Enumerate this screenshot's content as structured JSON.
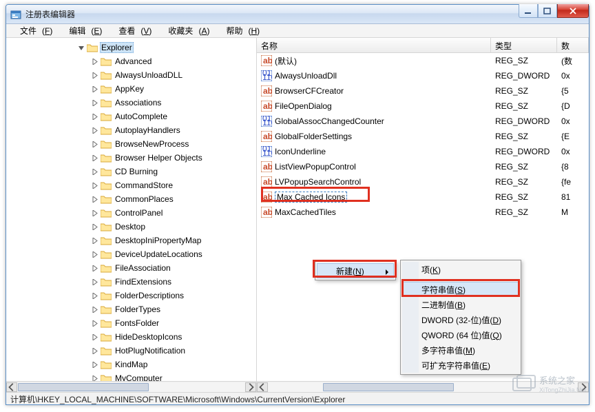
{
  "window": {
    "title": "注册表编辑器"
  },
  "menubar": [
    {
      "label": "文件",
      "mn": "F"
    },
    {
      "label": "编辑",
      "mn": "E"
    },
    {
      "label": "查看",
      "mn": "V"
    },
    {
      "label": "收藏夹",
      "mn": "A"
    },
    {
      "label": "帮助",
      "mn": "H"
    }
  ],
  "tree": {
    "root_label": "Explorer",
    "items": [
      "Advanced",
      "AlwaysUnloadDLL",
      "AppKey",
      "Associations",
      "AutoComplete",
      "AutoplayHandlers",
      "BrowseNewProcess",
      "Browser Helper Objects",
      "CD Burning",
      "CommandStore",
      "CommonPlaces",
      "ControlPanel",
      "Desktop",
      "DesktopIniPropertyMap",
      "DeviceUpdateLocations",
      "FileAssociation",
      "FindExtensions",
      "FolderDescriptions",
      "FolderTypes",
      "FontsFolder",
      "HideDesktopIcons",
      "HotPlugNotification",
      "KindMap",
      "MyComputer"
    ]
  },
  "list": {
    "headers": {
      "name": "名称",
      "type": "类型",
      "data": "数"
    },
    "rows": [
      {
        "name": "(默认)",
        "type": "REG_SZ",
        "data": "(数",
        "kind": "str"
      },
      {
        "name": "AlwaysUnloadDll",
        "type": "REG_DWORD",
        "data": "0x",
        "kind": "bin"
      },
      {
        "name": "BrowserCFCreator",
        "type": "REG_SZ",
        "data": "{5",
        "kind": "str"
      },
      {
        "name": "FileOpenDialog",
        "type": "REG_SZ",
        "data": "{D",
        "kind": "str"
      },
      {
        "name": "GlobalAssocChangedCounter",
        "type": "REG_DWORD",
        "data": "0x",
        "kind": "bin"
      },
      {
        "name": "GlobalFolderSettings",
        "type": "REG_SZ",
        "data": "{E",
        "kind": "str"
      },
      {
        "name": "IconUnderline",
        "type": "REG_DWORD",
        "data": "0x",
        "kind": "bin"
      },
      {
        "name": "ListViewPopupControl",
        "type": "REG_SZ",
        "data": "{8",
        "kind": "str"
      },
      {
        "name": "LVPopupSearchControl",
        "type": "REG_SZ",
        "data": "{fe",
        "kind": "str"
      },
      {
        "name": "Max Cached Icons",
        "type": "REG_SZ",
        "data": "81",
        "kind": "str",
        "editing": true
      },
      {
        "name": "MaxCachedTiles",
        "type": "REG_SZ",
        "data": "M",
        "kind": "str"
      }
    ]
  },
  "ctx1": {
    "label": "新建",
    "mn": "N"
  },
  "ctx2": [
    {
      "label": "项",
      "mn": "K"
    },
    {
      "sep": true
    },
    {
      "label": "字符串值",
      "mn": "S",
      "hov": true
    },
    {
      "label": "二进制值",
      "mn": "B"
    },
    {
      "label": "DWORD (32-位)值",
      "mn": "D"
    },
    {
      "label": "QWORD (64 位)值",
      "mn": "Q"
    },
    {
      "label": "多字符串值",
      "mn": "M"
    },
    {
      "label": "可扩充字符串值",
      "mn": "E"
    }
  ],
  "statusbar": "计算机\\HKEY_LOCAL_MACHINE\\SOFTWARE\\Microsoft\\Windows\\CurrentVersion\\Explorer",
  "watermark": "系统之家",
  "watermark_url": "XiTongZhiJia.Net"
}
